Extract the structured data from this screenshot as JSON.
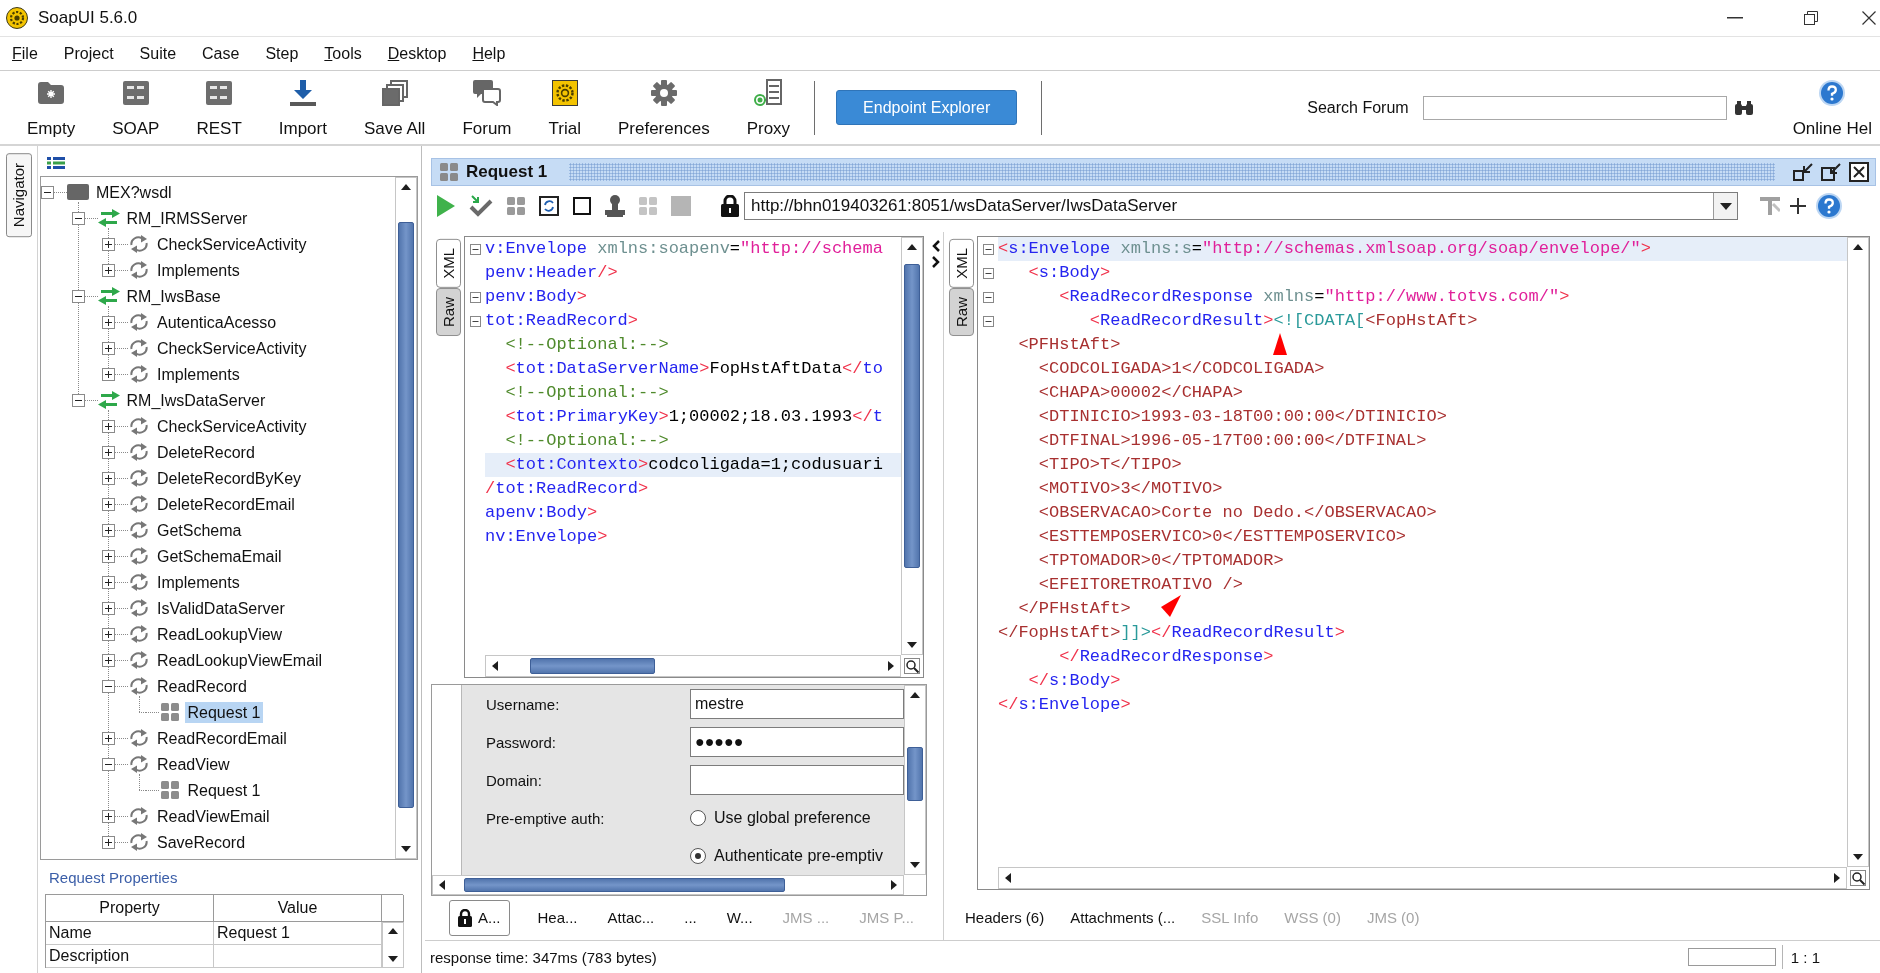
{
  "window": {
    "title": "SoapUI 5.6.0"
  },
  "menu": [
    {
      "label": "File",
      "mnemonic": true
    },
    {
      "label": "Project",
      "mnemonic": false
    },
    {
      "label": "Suite",
      "mnemonic": false
    },
    {
      "label": "Case",
      "mnemonic": false
    },
    {
      "label": "Step",
      "mnemonic": false
    },
    {
      "label": "Tools",
      "mnemonic": true
    },
    {
      "label": "Desktop",
      "mnemonic": true
    },
    {
      "label": "Help",
      "mnemonic": true
    }
  ],
  "toolbar": {
    "buttons": [
      {
        "label": "Empty"
      },
      {
        "label": "SOAP"
      },
      {
        "label": "REST"
      },
      {
        "label": "Import"
      },
      {
        "label": "Save All"
      },
      {
        "label": "Forum"
      },
      {
        "label": "Trial"
      },
      {
        "label": "Preferences"
      },
      {
        "label": "Proxy"
      }
    ],
    "endpoint_button": "Endpoint Explorer",
    "search_label": "Search Forum",
    "help_label": "Online Hel"
  },
  "navigator_tab": "Navigator",
  "tree": [
    {
      "label": "MEX?wsdl",
      "kind": "project",
      "expanded": true,
      "selected": false,
      "children": [
        {
          "label": "RM_IRMSServer",
          "kind": "interface",
          "expanded": true,
          "selected": false,
          "children": [
            {
              "label": "CheckServiceActivity",
              "kind": "operation",
              "expanded": false,
              "selected": false
            },
            {
              "label": "Implements",
              "kind": "operation",
              "expanded": false,
              "selected": false
            }
          ]
        },
        {
          "label": "RM_IwsBase",
          "kind": "interface",
          "expanded": true,
          "selected": false,
          "children": [
            {
              "label": "AutenticaAcesso",
              "kind": "operation",
              "expanded": false,
              "selected": false
            },
            {
              "label": "CheckServiceActivity",
              "kind": "operation",
              "expanded": false,
              "selected": false
            },
            {
              "label": "Implements",
              "kind": "operation",
              "expanded": false,
              "selected": false
            }
          ]
        },
        {
          "label": "RM_IwsDataServer",
          "kind": "interface",
          "expanded": true,
          "selected": false,
          "children": [
            {
              "label": "CheckServiceActivity",
              "kind": "operation",
              "expanded": false,
              "selected": false
            },
            {
              "label": "DeleteRecord",
              "kind": "operation",
              "expanded": false,
              "selected": false
            },
            {
              "label": "DeleteRecordByKey",
              "kind": "operation",
              "expanded": false,
              "selected": false
            },
            {
              "label": "DeleteRecordEmail",
              "kind": "operation",
              "expanded": false,
              "selected": false
            },
            {
              "label": "GetSchema",
              "kind": "operation",
              "expanded": false,
              "selected": false
            },
            {
              "label": "GetSchemaEmail",
              "kind": "operation",
              "expanded": false,
              "selected": false
            },
            {
              "label": "Implements",
              "kind": "operation",
              "expanded": false,
              "selected": false
            },
            {
              "label": "IsValidDataServer",
              "kind": "operation",
              "expanded": false,
              "selected": false
            },
            {
              "label": "ReadLookupView",
              "kind": "operation",
              "expanded": false,
              "selected": false
            },
            {
              "label": "ReadLookupViewEmail",
              "kind": "operation",
              "expanded": false,
              "selected": false
            },
            {
              "label": "ReadRecord",
              "kind": "operation",
              "expanded": true,
              "selected": false,
              "children": [
                {
                  "label": "Request 1",
                  "kind": "request",
                  "selected": true
                }
              ]
            },
            {
              "label": "ReadRecordEmail",
              "kind": "operation",
              "expanded": false,
              "selected": false
            },
            {
              "label": "ReadView",
              "kind": "operation",
              "expanded": true,
              "selected": false,
              "children": [
                {
                  "label": "Request 1",
                  "kind": "request",
                  "selected": false
                }
              ]
            },
            {
              "label": "ReadViewEmail",
              "kind": "operation",
              "expanded": false,
              "selected": false
            },
            {
              "label": "SaveRecord",
              "kind": "operation",
              "expanded": false,
              "selected": false
            }
          ]
        }
      ]
    }
  ],
  "properties": {
    "title": "Request Properties",
    "columns": [
      "Property",
      "Value"
    ],
    "rows": [
      {
        "property": "Name",
        "value": "Request 1"
      },
      {
        "property": "Description"
      }
    ]
  },
  "request_panel": {
    "title": "Request 1",
    "endpoint": "http://bhn019403261:8051/wsDataServer/IwsDataServer",
    "editor_tabs": [
      {
        "label": "XML",
        "selected": true
      },
      {
        "label": "Raw",
        "selected": false
      }
    ],
    "lines": [
      {
        "foldable": true,
        "current": false,
        "tokens": [
          {
            "kind": "tag",
            "text": "v:Envelope"
          },
          {
            "kind": "attr",
            "text": " xmlns:soapenv"
          },
          {
            "kind": "op",
            "text": "="
          },
          {
            "kind": "string",
            "text": "\"http://schema"
          }
        ]
      },
      {
        "foldable": false,
        "current": false,
        "tokens": [
          {
            "kind": "tag",
            "text": "penv:Header"
          },
          {
            "kind": "punct",
            "text": "/>"
          }
        ]
      },
      {
        "foldable": true,
        "current": false,
        "tokens": [
          {
            "kind": "tag",
            "text": "penv:Body"
          },
          {
            "kind": "punct",
            "text": ">"
          }
        ]
      },
      {
        "foldable": true,
        "current": false,
        "tokens": [
          {
            "kind": "tag",
            "text": "tot:ReadRecord"
          },
          {
            "kind": "punct",
            "text": ">"
          }
        ]
      },
      {
        "foldable": false,
        "current": false,
        "tokens": [
          {
            "kind": "comment",
            "text": "  <!--Optional:-->"
          }
        ]
      },
      {
        "foldable": false,
        "current": false,
        "tokens": [
          {
            "kind": "punct",
            "text": "  <"
          },
          {
            "kind": "tag",
            "text": "tot:DataServerName"
          },
          {
            "kind": "punct",
            "text": ">"
          },
          {
            "kind": "text",
            "text": "FopHstAftData"
          },
          {
            "kind": "punct",
            "text": "</"
          },
          {
            "kind": "tag",
            "text": "to"
          }
        ]
      },
      {
        "foldable": false,
        "current": false,
        "tokens": [
          {
            "kind": "comment",
            "text": "  <!--Optional:-->"
          }
        ]
      },
      {
        "foldable": false,
        "current": false,
        "tokens": [
          {
            "kind": "punct",
            "text": "  <"
          },
          {
            "kind": "tag",
            "text": "tot:PrimaryKey"
          },
          {
            "kind": "punct",
            "text": ">"
          },
          {
            "kind": "text",
            "text": "1;00002;18.03.1993"
          },
          {
            "kind": "punct",
            "text": "</"
          },
          {
            "kind": "tag",
            "text": "t"
          }
        ]
      },
      {
        "foldable": false,
        "current": false,
        "tokens": [
          {
            "kind": "comment",
            "text": "  <!--Optional:-->"
          }
        ]
      },
      {
        "foldable": false,
        "current": true,
        "tokens": [
          {
            "kind": "punct",
            "text": "  <"
          },
          {
            "kind": "tag",
            "text": "tot:Contexto"
          },
          {
            "kind": "punct",
            "text": ">"
          },
          {
            "kind": "text",
            "text": "codcoligada=1;codusuari"
          }
        ]
      },
      {
        "foldable": false,
        "current": false,
        "tokens": [
          {
            "kind": "punct",
            "text": "/"
          },
          {
            "kind": "tag",
            "text": "tot:ReadRecord"
          },
          {
            "kind": "punct",
            "text": ">"
          }
        ]
      },
      {
        "foldable": false,
        "current": false,
        "tokens": [
          {
            "kind": "tag",
            "text": "apenv:Body"
          },
          {
            "kind": "punct",
            "text": ">"
          }
        ]
      },
      {
        "foldable": false,
        "current": false,
        "tokens": [
          {
            "kind": "tag",
            "text": "nv:Envelope"
          },
          {
            "kind": "punct",
            "text": ">"
          }
        ]
      }
    ],
    "auth": {
      "fields": [
        {
          "label": "Username:",
          "value": "mestre"
        },
        {
          "label": "Password:",
          "value": "●●●●●"
        },
        {
          "label": "Domain:"
        }
      ],
      "preemptive": {
        "label": "Pre-emptive auth:",
        "options": [
          {
            "label": "Use global preference",
            "selected": false
          },
          {
            "label": "Authenticate pre-emptiv",
            "selected": true
          }
        ]
      }
    },
    "tabs": [
      {
        "label": "A...",
        "selected": true,
        "disabled": false,
        "locked": true
      },
      {
        "label": "Hea...",
        "selected": false,
        "disabled": false,
        "locked": false
      },
      {
        "label": "Attac...",
        "selected": false,
        "disabled": false,
        "locked": false
      },
      {
        "label": "...",
        "selected": false,
        "disabled": false,
        "locked": false
      },
      {
        "label": "W...",
        "selected": false,
        "disabled": false,
        "locked": false
      },
      {
        "label": "JMS ...",
        "selected": false,
        "disabled": true,
        "locked": false
      },
      {
        "label": "JMS P...",
        "selected": false,
        "disabled": true,
        "locked": false
      }
    ]
  },
  "response_panel": {
    "editor_tabs": [
      {
        "label": "XML",
        "selected": true
      },
      {
        "label": "Raw",
        "selected": false
      }
    ],
    "lines": [
      {
        "foldable": true,
        "current": true,
        "tokens": [
          {
            "kind": "punct",
            "text": "<"
          },
          {
            "kind": "tag",
            "text": "s:Envelope"
          },
          {
            "kind": "attr",
            "text": " xmlns:s"
          },
          {
            "kind": "op",
            "text": "="
          },
          {
            "kind": "string",
            "text": "\"http://schemas.xmlsoap.org/soap/envelope/\""
          },
          {
            "kind": "punct",
            "text": ">"
          }
        ]
      },
      {
        "foldable": true,
        "current": false,
        "tokens": [
          {
            "kind": "punct",
            "text": "   <"
          },
          {
            "kind": "tag",
            "text": "s:Body"
          },
          {
            "kind": "punct",
            "text": ">"
          }
        ]
      },
      {
        "foldable": true,
        "current": false,
        "tokens": [
          {
            "kind": "punct",
            "text": "      <"
          },
          {
            "kind": "tag",
            "text": "ReadRecordResponse"
          },
          {
            "kind": "attr",
            "text": " xmlns"
          },
          {
            "kind": "op",
            "text": "="
          },
          {
            "kind": "string",
            "text": "\"http://www.totvs.com/\""
          },
          {
            "kind": "punct",
            "text": ">"
          }
        ]
      },
      {
        "foldable": true,
        "current": false,
        "tokens": [
          {
            "kind": "punct",
            "text": "         <"
          },
          {
            "kind": "tag",
            "text": "ReadRecordResult"
          },
          {
            "kind": "punct",
            "text": ">"
          },
          {
            "kind": "cdata",
            "text": "<![CDATA["
          },
          {
            "kind": "content",
            "text": "<FopHstAft>"
          }
        ]
      },
      {
        "foldable": false,
        "current": false,
        "tokens": [
          {
            "kind": "content",
            "text": "  <PFHstAft>"
          }
        ]
      },
      {
        "foldable": false,
        "current": false,
        "tokens": [
          {
            "kind": "content",
            "text": "    <CODCOLIGADA>1</CODCOLIGADA>"
          }
        ]
      },
      {
        "foldable": false,
        "current": false,
        "tokens": [
          {
            "kind": "content",
            "text": "    <CHAPA>00002</CHAPA>"
          }
        ]
      },
      {
        "foldable": false,
        "current": false,
        "tokens": [
          {
            "kind": "content",
            "text": "    <DTINICIO>1993-03-18T00:00:00</DTINICIO>"
          }
        ]
      },
      {
        "foldable": false,
        "current": false,
        "tokens": [
          {
            "kind": "content",
            "text": "    <DTFINAL>1996-05-17T00:00:00</DTFINAL>"
          }
        ]
      },
      {
        "foldable": false,
        "current": false,
        "tokens": [
          {
            "kind": "content",
            "text": "    <TIPO>T</TIPO>"
          }
        ]
      },
      {
        "foldable": false,
        "current": false,
        "tokens": [
          {
            "kind": "content",
            "text": "    <MOTIVO>3</MOTIVO>"
          }
        ]
      },
      {
        "foldable": false,
        "current": false,
        "tokens": [
          {
            "kind": "content",
            "text": "    <OBSERVACAO>Corte no Dedo.</OBSERVACAO>"
          }
        ]
      },
      {
        "foldable": false,
        "current": false,
        "tokens": [
          {
            "kind": "content",
            "text": "    <ESTTEMPOSERVICO>0</ESTTEMPOSERVICO>"
          }
        ]
      },
      {
        "foldable": false,
        "current": false,
        "tokens": [
          {
            "kind": "content",
            "text": "    <TPTOMADOR>0</TPTOMADOR>"
          }
        ]
      },
      {
        "foldable": false,
        "current": false,
        "tokens": [
          {
            "kind": "content",
            "text": "    <EFEITORETROATIVO />"
          }
        ]
      },
      {
        "foldable": false,
        "current": false,
        "tokens": [
          {
            "kind": "content",
            "text": "  </PFHstAft>"
          }
        ]
      },
      {
        "foldable": false,
        "current": false,
        "tokens": [
          {
            "kind": "content",
            "text": "</FopHstAft>"
          },
          {
            "kind": "cdata",
            "text": "]]>"
          },
          {
            "kind": "punct",
            "text": "</"
          },
          {
            "kind": "tag",
            "text": "ReadRecordResult"
          },
          {
            "kind": "punct",
            "text": ">"
          }
        ]
      },
      {
        "foldable": false,
        "current": false,
        "tokens": [
          {
            "kind": "punct",
            "text": "      </"
          },
          {
            "kind": "tag",
            "text": "ReadRecordResponse"
          },
          {
            "kind": "punct",
            "text": ">"
          }
        ]
      },
      {
        "foldable": false,
        "current": false,
        "tokens": [
          {
            "kind": "punct",
            "text": "   </"
          },
          {
            "kind": "tag",
            "text": "s:Body"
          },
          {
            "kind": "punct",
            "text": ">"
          }
        ]
      },
      {
        "foldable": false,
        "current": false,
        "tokens": [
          {
            "kind": "punct",
            "text": "</"
          },
          {
            "kind": "tag",
            "text": "s:Envelope"
          },
          {
            "kind": "punct",
            "text": ">"
          }
        ]
      }
    ],
    "tabs": [
      {
        "label": "Headers (6)",
        "selected": false,
        "disabled": false
      },
      {
        "label": "Attachments (...",
        "selected": false,
        "disabled": false
      },
      {
        "label": "SSL Info",
        "selected": false,
        "disabled": true
      },
      {
        "label": "WSS (0)",
        "selected": false,
        "disabled": true
      },
      {
        "label": "JMS (0)",
        "selected": false,
        "disabled": true
      }
    ]
  },
  "status_bar": {
    "text": "response time: 347ms (783 bytes)",
    "position": "1 : 1"
  }
}
